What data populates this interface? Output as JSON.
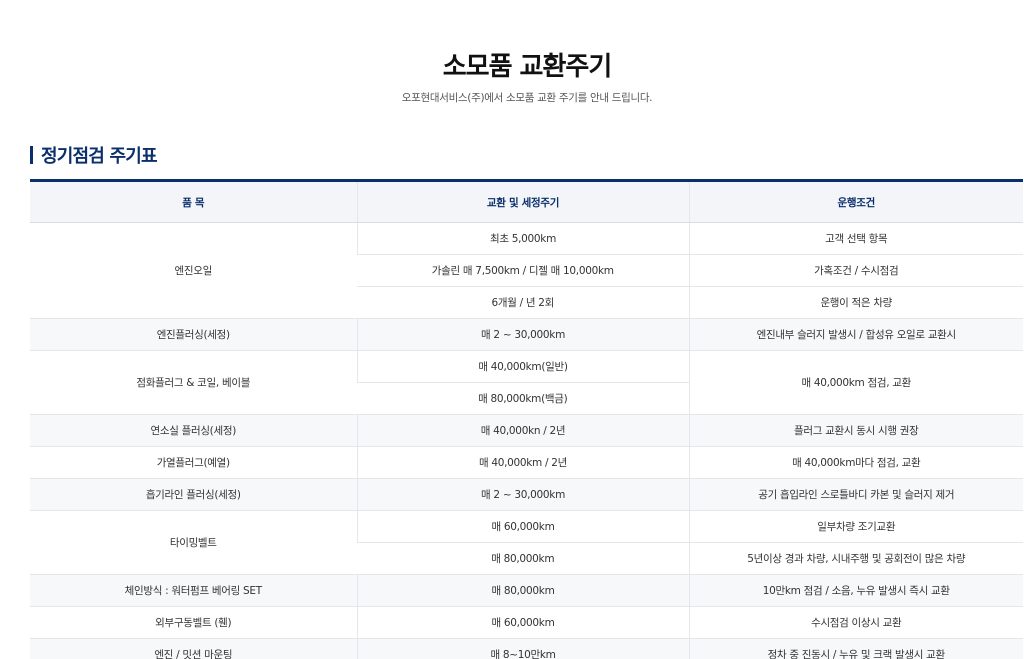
{
  "header": {
    "title": "소모품 교환주기",
    "subtitle": "오포현대서비스(주)에서 소모품 교환 주기를 안내 드립니다."
  },
  "section": {
    "title": "정기점검 주기표"
  },
  "table": {
    "headers": [
      "품 목",
      "교환 및 세정주기",
      "운행조건"
    ],
    "rows": [
      {
        "item": "엔진오일",
        "cycle": "최초 5,000km",
        "condition": "고객 선택 항목"
      },
      {
        "cycle": "가솔린 매 7,500km / 디젤 매 10,000km",
        "condition": "가혹조건 / 수시점검"
      },
      {
        "cycle": "6개월 / 년 2회",
        "condition": "운행이 적은 차량"
      },
      {
        "item": "엔진플러싱(세정)",
        "cycle": "매 2 ~ 30,000km",
        "condition": "엔진내부 슬러지 발생시 / 합성유 오일로 교환시"
      },
      {
        "item": "점화플러그 & 코일, 베이블",
        "cycle": "매 40,000km(일반)",
        "condition": "매 40,000km 점검, 교환"
      },
      {
        "cycle": "매 80,000km(백금)"
      },
      {
        "item": "연소실 플러싱(세정)",
        "cycle": "매 40,000kn / 2년",
        "condition": "플러그 교환시 동시 시행 권장"
      },
      {
        "item": "가열플러그(예열)",
        "cycle": "매 40,000km / 2년",
        "condition": "매 40,000km마다 점검, 교환"
      },
      {
        "item": "흡기라인 플러싱(세정)",
        "cycle": "매 2 ~ 30,000km",
        "condition": "공기 흡입라인 스로틀바디 카본 및 슬러지 제거"
      },
      {
        "item": "타이밍벨트",
        "cycle": "매 60,000km",
        "condition": "일부차량 조기교환"
      },
      {
        "cycle": "매 80,000km",
        "condition": "5년이상 경과 차량, 시내주행 및 공회전이 많은 차량"
      },
      {
        "item": "체인방식 : 워터펌프 베어링 SET",
        "cycle": "매 80,000km",
        "condition": "10만km 점검 / 소음, 누유 발생시 즉시 교환"
      },
      {
        "item": "외부구동벨트 (휀)",
        "cycle": "매 60,000km",
        "condition": "수시점검 이상시 교환"
      },
      {
        "item": "엔진 / 밋션 마운팅",
        "cycle": "매 8~10만km",
        "condition": "정차 중 진동시 / 누유 및 크랙 발생시 교환"
      }
    ]
  }
}
